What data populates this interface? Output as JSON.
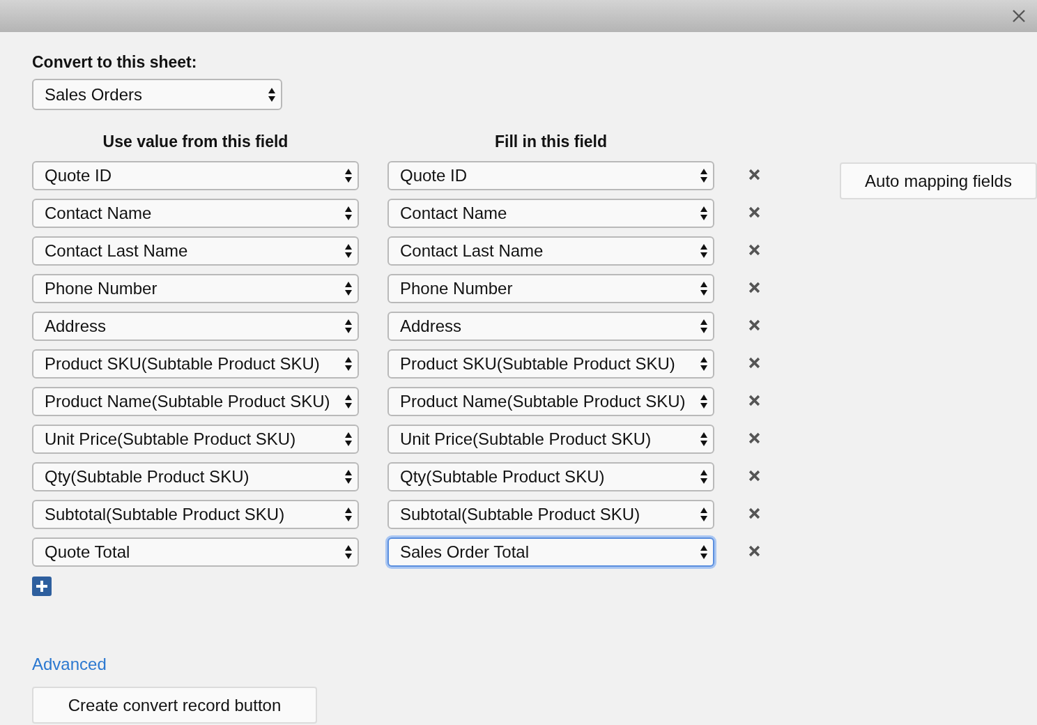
{
  "sheet": {
    "label": "Convert to this sheet:",
    "value": "Sales Orders"
  },
  "columns": [
    "Use value from this field",
    "Fill in this field"
  ],
  "mappings": [
    {
      "source": "Quote ID",
      "target": "Quote ID",
      "focused": false
    },
    {
      "source": "Contact Name",
      "target": "Contact Name",
      "focused": false
    },
    {
      "source": "Contact Last Name",
      "target": "Contact Last Name",
      "focused": false
    },
    {
      "source": "Phone Number",
      "target": "Phone Number",
      "focused": false
    },
    {
      "source": "Address",
      "target": "Address",
      "focused": false
    },
    {
      "source": "Product SKU(Subtable Product SKU)",
      "target": "Product SKU(Subtable Product SKU)",
      "focused": false
    },
    {
      "source": "Product Name(Subtable Product SKU)",
      "target": "Product Name(Subtable Product SKU)",
      "focused": false
    },
    {
      "source": "Unit Price(Subtable Product SKU)",
      "target": "Unit Price(Subtable Product SKU)",
      "focused": false
    },
    {
      "source": "Qty(Subtable Product SKU)",
      "target": "Qty(Subtable Product SKU)",
      "focused": false
    },
    {
      "source": "Subtotal(Subtable Product SKU)",
      "target": "Subtotal(Subtable Product SKU)",
      "focused": false
    },
    {
      "source": "Quote Total",
      "target": "Sales Order Total",
      "focused": true
    }
  ],
  "auto_button": "Auto mapping fields",
  "advanced_link": "Advanced",
  "create_button": "Create convert record button"
}
